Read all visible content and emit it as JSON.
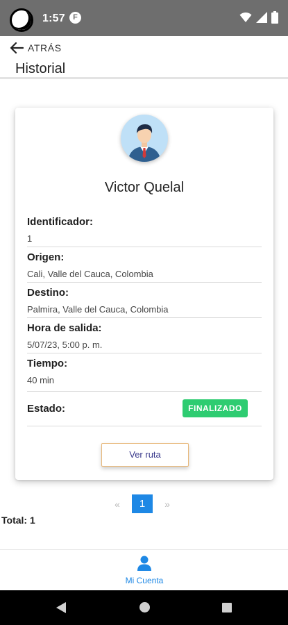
{
  "status_bar": {
    "time": "1:57",
    "notification_badge": "F"
  },
  "header": {
    "back_label": "ATRÁS",
    "title": "Historial"
  },
  "card": {
    "user_name": "Victor Quelal",
    "fields": [
      {
        "label": "Identificador:",
        "value": "1"
      },
      {
        "label": "Origen:",
        "value": "Cali, Valle del Cauca, Colombia"
      },
      {
        "label": "Destino:",
        "value": "Palmira, Valle del Cauca, Colombia"
      },
      {
        "label": "Hora de salida:",
        "value": "5/07/23, 5:00 p. m."
      },
      {
        "label": "Tiempo:",
        "value": "40 min"
      }
    ],
    "estado_label": "Estado:",
    "estado_badge": "FINALIZADO",
    "route_button": "Ver ruta"
  },
  "pagination": {
    "prev": "«",
    "current_page": "1",
    "next": "»"
  },
  "total": "Total: 1",
  "bottom_nav": {
    "item_label": "Mi Cuenta"
  },
  "colors": {
    "accent": "#1e88e5",
    "status_success": "#2ecc71",
    "status_bar": "#6e6e6e"
  }
}
